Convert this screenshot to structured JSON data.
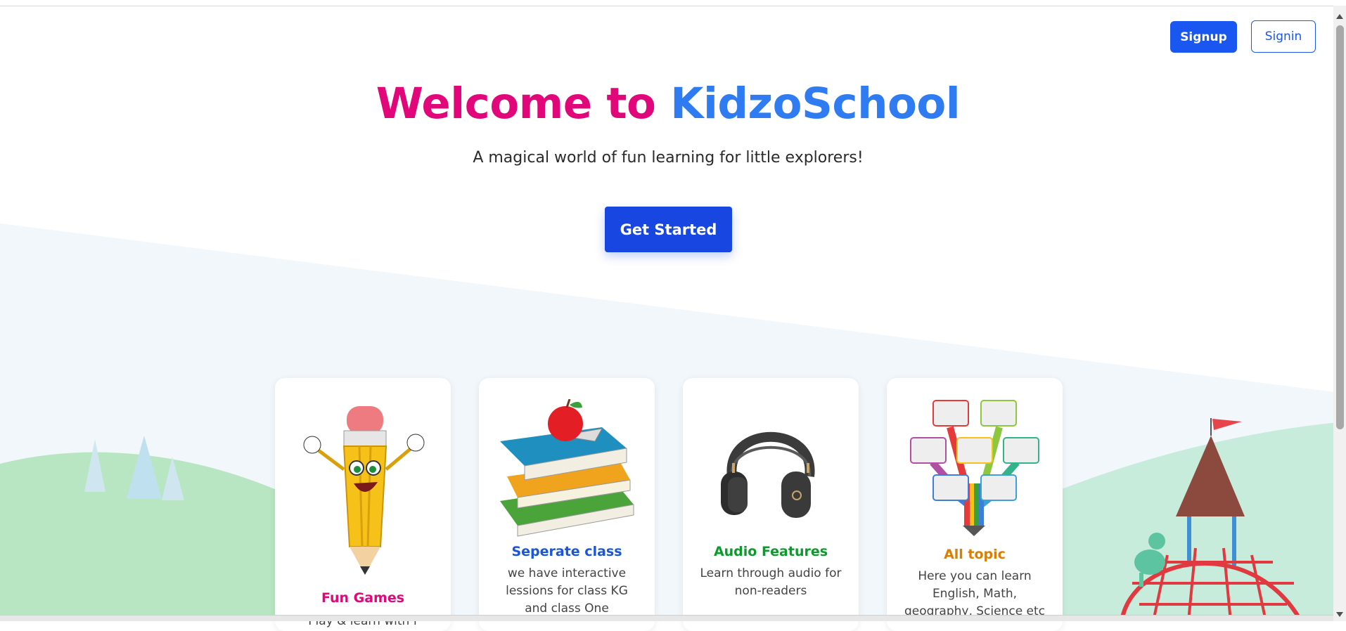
{
  "header": {
    "signup_label": "Signup",
    "signin_label": "Signin"
  },
  "hero": {
    "title_part1": "Welcome to",
    "title_part2": "KidzoSchool",
    "subtitle": "A magical world of fun learning for little explorers!",
    "cta_label": "Get Started"
  },
  "features": [
    {
      "title": "Fun Games",
      "description": "Play & learn with f",
      "color": "#e1077a",
      "icon": "pencil-mascot-icon"
    },
    {
      "title": "Seperate class",
      "description": "we have interactive lessions for class KG and class One",
      "color": "#1a56d8",
      "icon": "books-apple-icon"
    },
    {
      "title": "Audio Features",
      "description": "Learn through audio for non-readers",
      "color": "#0b9b2b",
      "icon": "headphones-icon"
    },
    {
      "title": "All topic",
      "description": "Here you can learn English, Math, geography, Science etc",
      "color": "#d97f06",
      "icon": "topic-tree-icon"
    }
  ],
  "colors": {
    "brand_pink": "#e1077a",
    "brand_blue": "#2f7bf2",
    "button_blue": "#1a56f0"
  }
}
